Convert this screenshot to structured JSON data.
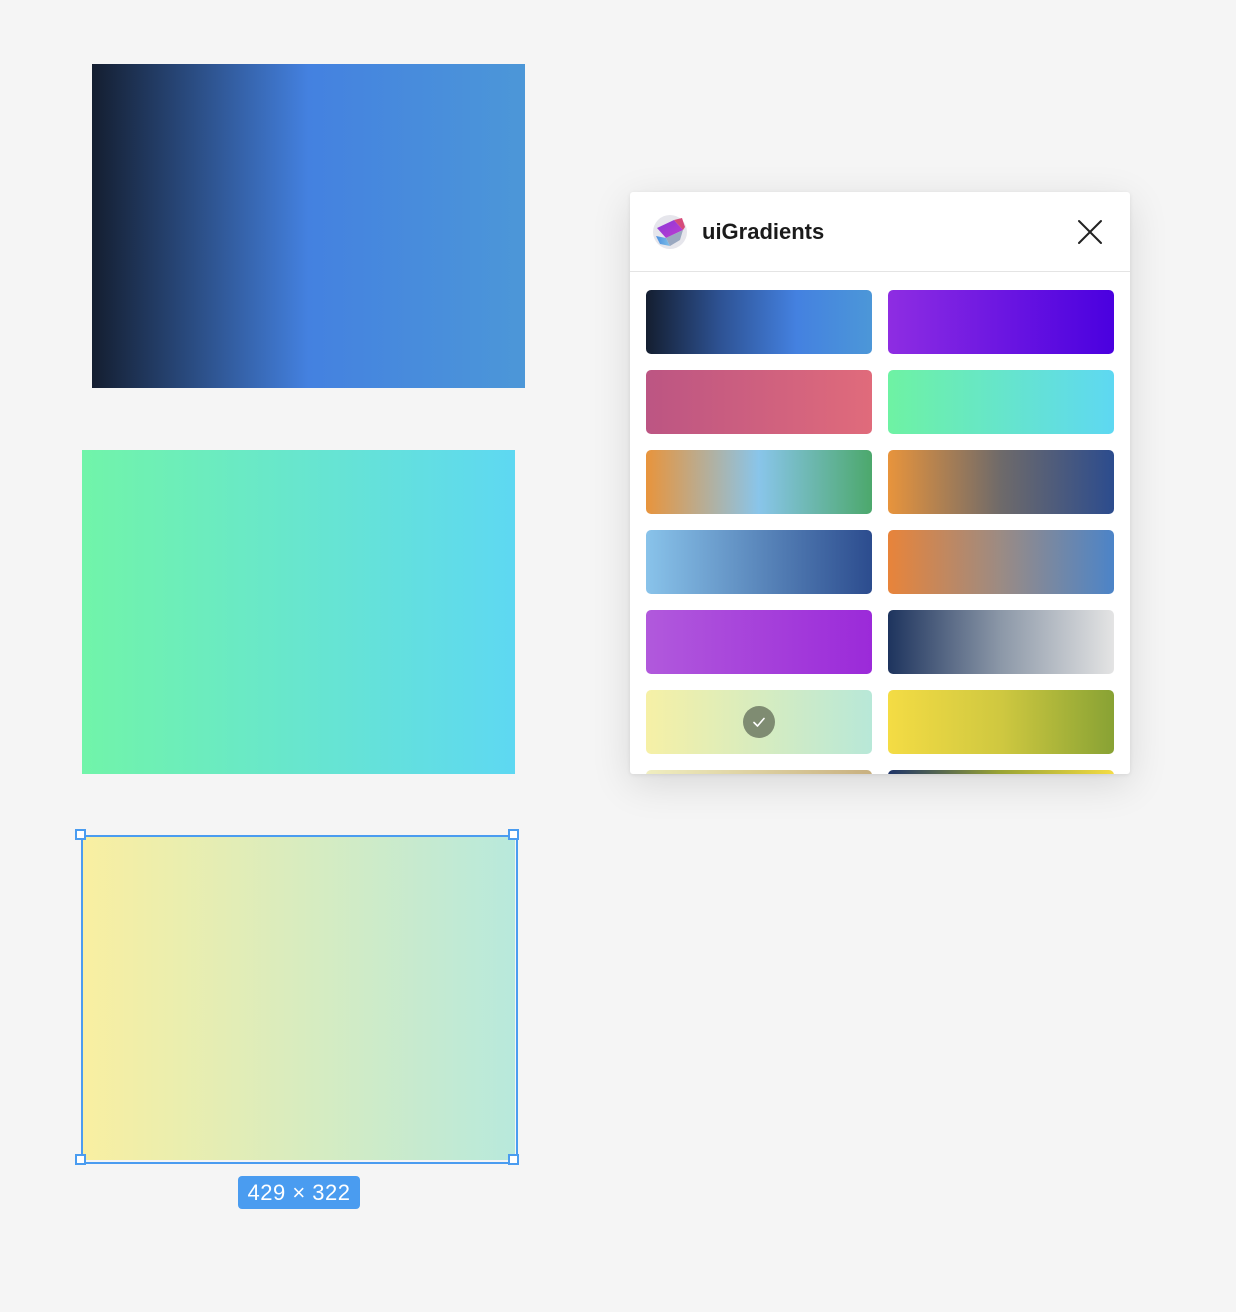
{
  "canvas": {
    "rectangles": [
      {
        "id": "rect-1",
        "colors": [
          "#141e30",
          "#4481e0",
          "#4c97d8"
        ]
      },
      {
        "id": "rect-2",
        "colors": [
          "#71f4a9",
          "#5ed8f2"
        ]
      },
      {
        "id": "rect-3",
        "colors": [
          "#f9efa1",
          "#b8e9dc"
        ]
      }
    ],
    "selection": {
      "dimensions_label": "429 × 322",
      "accent_color": "#4a9cf0"
    }
  },
  "plugin": {
    "title": "uiGradients",
    "icon": "uigradients-logo-icon",
    "close_icon": "close-icon",
    "swatches": [
      {
        "colors": [
          "#141e30",
          "#2e5395",
          "#4481e0",
          "#4c97d8"
        ]
      },
      {
        "colors": [
          "#8e2de2",
          "#4a00e0"
        ]
      },
      {
        "colors": [
          "#bc5583",
          "#e06b7b"
        ]
      },
      {
        "colors": [
          "#6ef2a3",
          "#5ed8f2"
        ]
      },
      {
        "colors": [
          "#e8943c",
          "#89c5ea",
          "#4ca86c"
        ]
      },
      {
        "colors": [
          "#e8943c",
          "#6e6a6a",
          "#2c4c8e"
        ]
      },
      {
        "colors": [
          "#89c3ea",
          "#2c4c8e"
        ]
      },
      {
        "colors": [
          "#e8843a",
          "#9b8b84",
          "#4c84c8"
        ]
      },
      {
        "colors": [
          "#b159dc",
          "#9b2ad9"
        ]
      },
      {
        "colors": [
          "#1e345e",
          "#8c98a8",
          "#e4e4e4"
        ]
      },
      {
        "colors": [
          "#f6f0a6",
          "#b8e8d8"
        ],
        "selected": true,
        "check_icon": "check-icon"
      },
      {
        "colors": [
          "#f4dc44",
          "#cfc840",
          "#88a234"
        ]
      },
      {
        "colors": [
          "#f0eec0",
          "#c8b080"
        ]
      },
      {
        "colors": [
          "#1e3468",
          "#9aa434",
          "#f4dc44"
        ]
      }
    ]
  }
}
